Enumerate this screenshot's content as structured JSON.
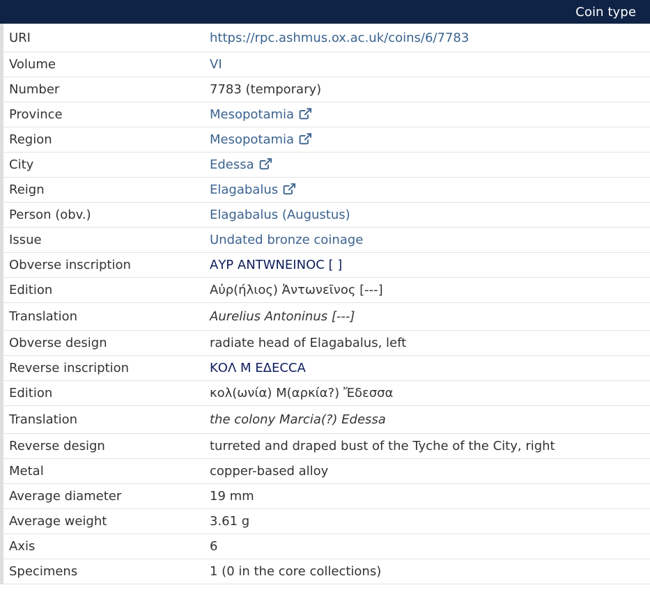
{
  "header": {
    "title": "Coin type"
  },
  "colors": {
    "header_bg": "#0f2346",
    "link": "#3b6390",
    "inscription": "#0d1d5e"
  },
  "rows": {
    "uri": {
      "label": "URI",
      "value": "https://rpc.ashmus.ox.ac.uk/coins/6/7783"
    },
    "volume": {
      "label": "Volume",
      "value": "VI"
    },
    "number": {
      "label": "Number",
      "value": "7783 (temporary)"
    },
    "province": {
      "label": "Province",
      "value": "Mesopotamia",
      "icon": "external-link-icon"
    },
    "region": {
      "label": "Region",
      "value": "Mesopotamia",
      "icon": "external-link-icon"
    },
    "city": {
      "label": "City",
      "value": "Edessa",
      "icon": "external-link-icon"
    },
    "reign": {
      "label": "Reign",
      "value": "Elagabalus",
      "icon": "external-link-icon"
    },
    "person_obv": {
      "label": "Person (obv.)",
      "value": "Elagabalus (Augustus)"
    },
    "issue": {
      "label": "Issue",
      "value": "Undated bronze coinage"
    },
    "obverse_inscription": {
      "label": "Obverse inscription",
      "value": "ΑΥΡ ΑΝΤWΝΕΙΝΟϹ [ ]"
    },
    "obverse_edition": {
      "label": "Edition",
      "value": "Αὐρ(ήλιος) Ἀντωνεῖνος [---]"
    },
    "obverse_translation": {
      "label": "Translation",
      "value": "Aurelius Antoninus [---]"
    },
    "obverse_design": {
      "label": "Obverse design",
      "value": "radiate head of Elagabalus, left"
    },
    "reverse_inscription": {
      "label": "Reverse inscription",
      "value": "ΚΟΛ Μ ΕΔΕϹϹΑ"
    },
    "reverse_edition": {
      "label": "Edition",
      "value": "κολ(ωνία) Μ(αρκία?) Ἔδεσσα"
    },
    "reverse_translation": {
      "label": "Translation",
      "value": "the colony Marcia(?) Edessa"
    },
    "reverse_design": {
      "label": "Reverse design",
      "value": "turreted and draped bust of the Tyche of the City, right"
    },
    "metal": {
      "label": "Metal",
      "value": "copper-based alloy"
    },
    "average_diameter": {
      "label": "Average diameter",
      "value": "19 mm"
    },
    "average_weight": {
      "label": "Average weight",
      "value": "3.61 g"
    },
    "axis": {
      "label": "Axis",
      "value": "6"
    },
    "specimens": {
      "label": "Specimens",
      "value": "1 (0 in the core collections)"
    }
  }
}
